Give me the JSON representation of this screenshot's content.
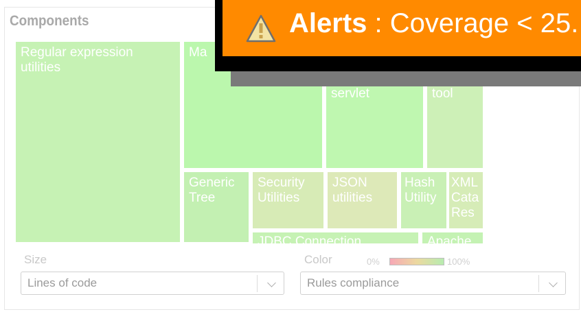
{
  "widget": {
    "title": "Components",
    "treemap": {
      "cells": [
        {
          "label": "Regular expression utilities",
          "color": "#c6f2b4"
        },
        {
          "label": "Ma",
          "color": "#bbf7ad"
        },
        {
          "label": "servlet",
          "color": "#bff7b0"
        },
        {
          "label": "tool",
          "color": "#cdf0b7"
        },
        {
          "label": "Generic Tree",
          "color": "#c3f0b2"
        },
        {
          "label": "Security Utilities",
          "color": "#d7ebb6"
        },
        {
          "label": "JSON utilities",
          "color": "#dde9b8"
        },
        {
          "label": "Hash Utility",
          "color": "#c9f0b5"
        },
        {
          "label": "XML Cata Res",
          "color": "#d6ecb7"
        },
        {
          "label": "JDBC Connection",
          "color": "#c6f2b4"
        },
        {
          "label": "Apache",
          "color": "#c4f2b3"
        }
      ]
    },
    "size": {
      "label": "Size",
      "selected": "Lines of code"
    },
    "color": {
      "label": "Color",
      "min_label": "0%",
      "max_label": "100%",
      "selected": "Rules compliance"
    }
  },
  "alert": {
    "prefix": "Alerts",
    "message": " : Coverage < 25."
  }
}
